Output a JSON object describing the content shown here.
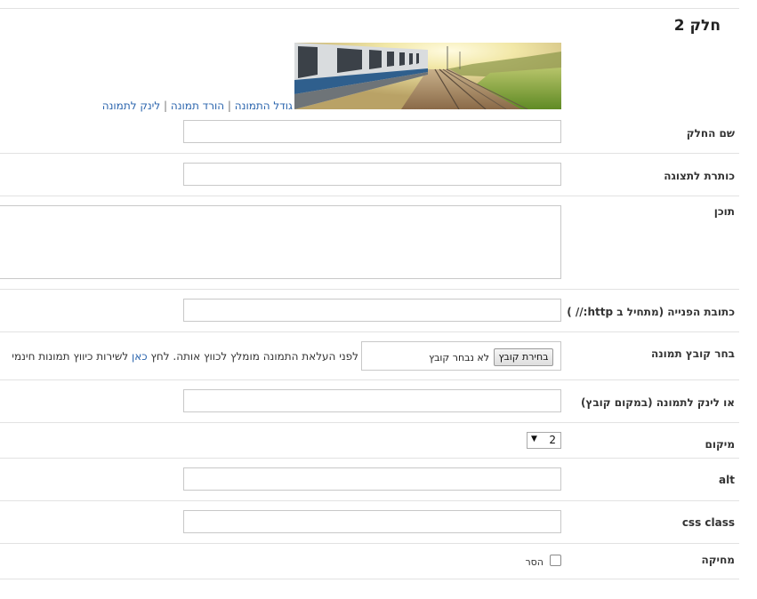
{
  "section": {
    "title": "חלק 2"
  },
  "image_links": {
    "image_size": "גודל התמונה",
    "download_image": "הורד תמונה",
    "image_link": "לינק לתמונה",
    "separator": "|"
  },
  "fields": {
    "part_name": {
      "label": "שם החלק",
      "value": ""
    },
    "display_title": {
      "label": "כותרת לתצוגה",
      "value": ""
    },
    "content": {
      "label": "תוכן",
      "value": ""
    },
    "reference_url": {
      "label": "כתובת הפנייה (מתחיל ב http:// )",
      "value": ""
    },
    "image_file": {
      "label": "בחר קובץ תמונה",
      "button": "בחירת קובץ",
      "no_file": "לא נבחר קובץ",
      "note_before": "לפני העלאת התמונה מומלץ לכווץ אותה. לחץ ",
      "note_link": "כאן",
      "note_after": " לשירות כיווץ תמונות חינמי"
    },
    "image_link_url": {
      "label": "או לינק לתמונה (במקום קובץ)",
      "value": ""
    },
    "position": {
      "label": "מיקום",
      "selected": "2",
      "arrow": "▼"
    },
    "alt": {
      "label": "alt",
      "value": ""
    },
    "css_class": {
      "label": "css class",
      "value": ""
    },
    "delete": {
      "label": "מחיקה",
      "checkbox_label": "הסר",
      "checked": false
    }
  },
  "icons": {
    "dropdown": "chevron-down-icon",
    "checkbox": "checkbox-icon",
    "photo": "train-photo"
  },
  "colors": {
    "link": "#2a64ad",
    "divider": "#e2e2e2",
    "input_border": "#c8c8c8"
  }
}
